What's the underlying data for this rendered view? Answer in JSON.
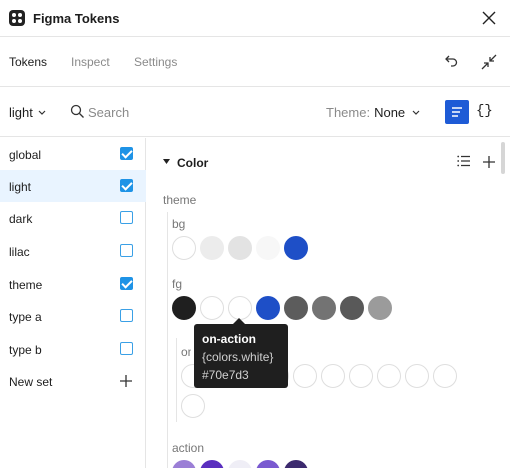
{
  "app": {
    "title": "Figma Tokens"
  },
  "tabs": [
    {
      "label": "Tokens",
      "active": true
    },
    {
      "label": "Inspect",
      "active": false
    },
    {
      "label": "Settings",
      "active": false
    }
  ],
  "toolbar": {
    "set_selector": "light",
    "search_placeholder": "Search",
    "theme_label": "Theme:",
    "theme_value": "None"
  },
  "sets": [
    {
      "name": "global",
      "checked": true
    },
    {
      "name": "light",
      "checked": true,
      "active": true
    },
    {
      "name": "dark",
      "checked": false
    },
    {
      "name": "lilac",
      "checked": false
    },
    {
      "name": "theme",
      "checked": true
    },
    {
      "name": "type a",
      "checked": false
    },
    {
      "name": "type b",
      "checked": false
    }
  ],
  "new_set_label": "New set",
  "section": {
    "title": "Color"
  },
  "groups": {
    "theme": "theme",
    "bg": "bg",
    "fg": "fg",
    "on": "on",
    "action": "action"
  },
  "swatches": {
    "bg": [
      "#ffffff",
      "#ececec",
      "#e3e3e3",
      "#f7f7f7",
      "#1e4fc7"
    ],
    "fg": [
      "#1f1f1f",
      "#ffffff",
      "#ffffff",
      "#1e4fc7",
      "#5c5c5c",
      "#737373",
      "#595959",
      "#9b9b9b"
    ],
    "on": [
      "#ffffff",
      "#ffffff",
      "#ffffff",
      "#ffffff",
      "#ffffff",
      "#ffffff",
      "#ffffff",
      "#ffffff",
      "#ffffff",
      "#ffffff",
      "#ffffff"
    ],
    "action": [
      "#9b7fd6",
      "#5a2fbf",
      "#efeef6",
      "#7a5ad0",
      "#3c2a6e"
    ]
  },
  "tooltip": {
    "name": "on-action",
    "reference": "{colors.white}",
    "value": "#70e7d3"
  },
  "colors": {
    "accent": "#1e5bd6",
    "checkbox": "#1e93e6",
    "active_row": "#e9f4ff"
  }
}
